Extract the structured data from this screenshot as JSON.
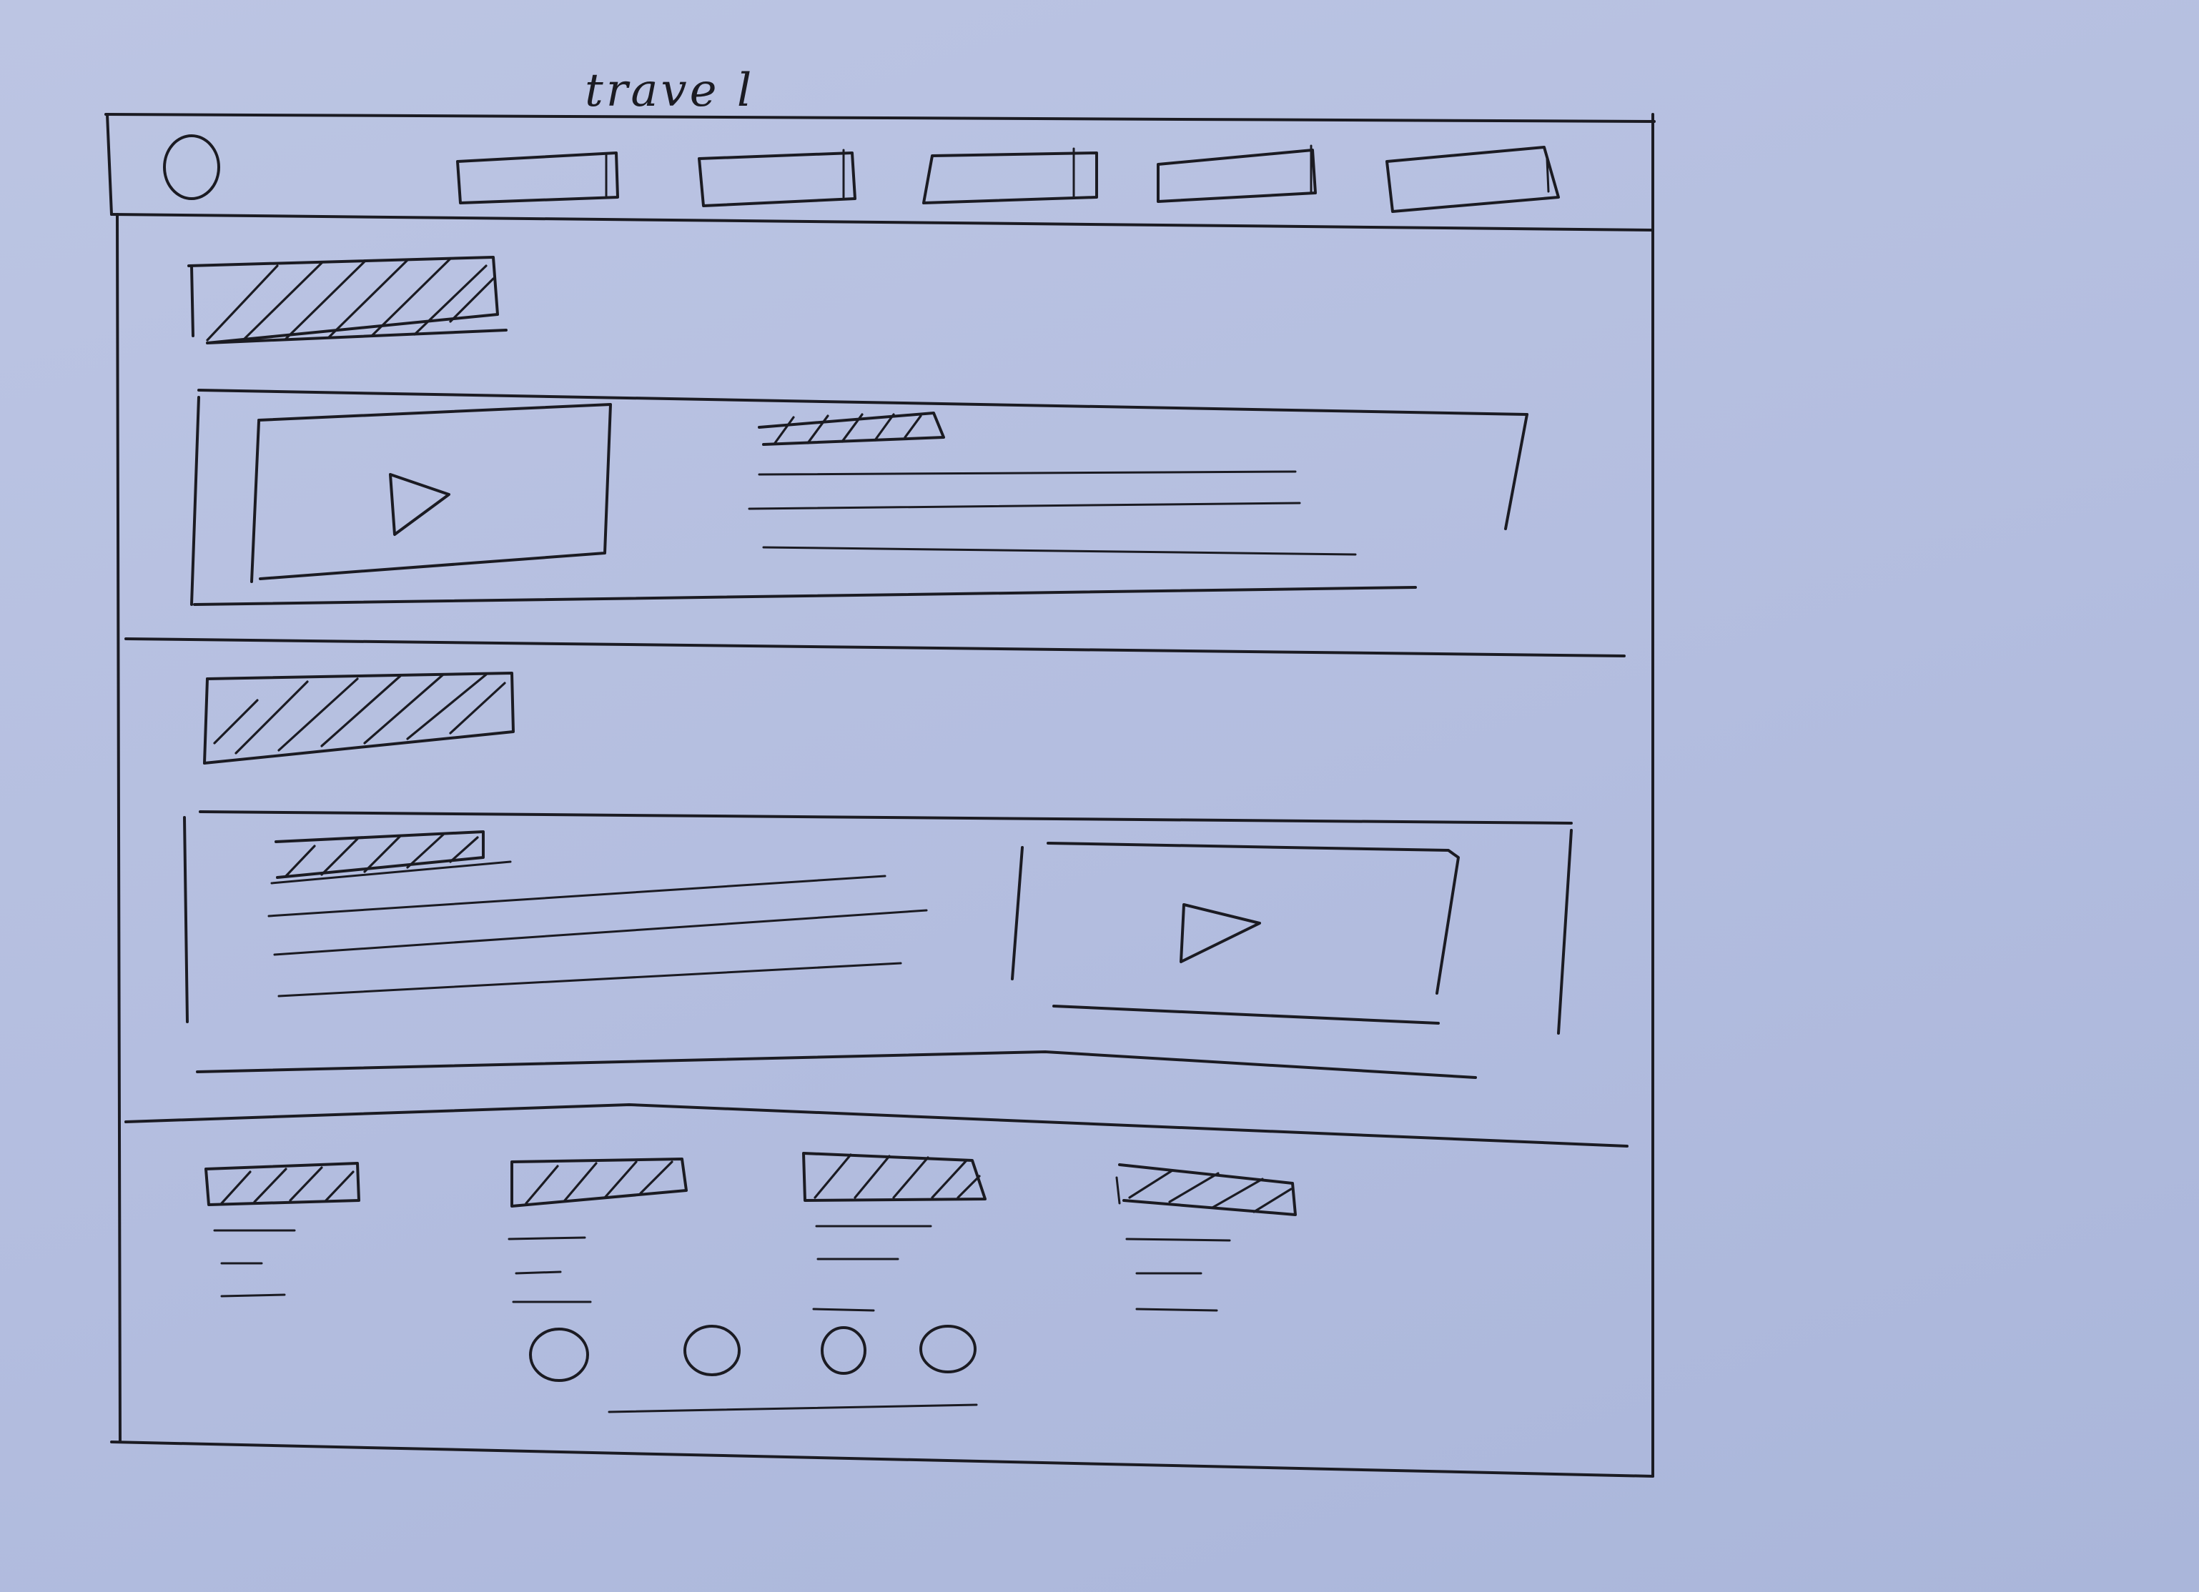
{
  "sketch": {
    "title": "trave l",
    "nav": {
      "logo_icon": "circle-logo-icon",
      "tabs": [
        {
          "label": ""
        },
        {
          "label": ""
        },
        {
          "label": ""
        },
        {
          "label": ""
        },
        {
          "label": ""
        }
      ]
    },
    "section_one": {
      "video_icon": "play-icon",
      "text_lines": 4
    },
    "section_two": {
      "video_icon": "play-icon",
      "text_lines": 4
    },
    "footer": {
      "columns": 4,
      "social_icons": [
        "circle-icon",
        "circle-icon",
        "circle-icon",
        "circle-icon"
      ]
    },
    "ink_color": "#1b1b22",
    "paper_color": "#b7c0df"
  }
}
